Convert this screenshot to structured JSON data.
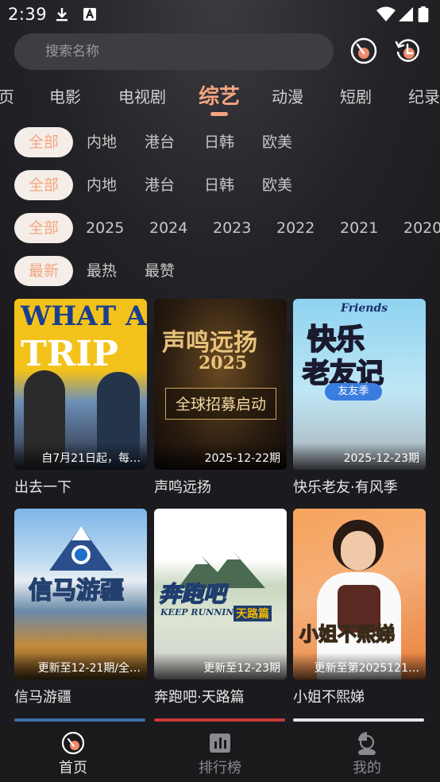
{
  "status_bar": {
    "time": "2:39"
  },
  "search": {
    "placeholder": "搜索名称"
  },
  "categories": [
    {
      "label": "页"
    },
    {
      "label": "电影"
    },
    {
      "label": "电视剧"
    },
    {
      "label": "综艺",
      "active": true
    },
    {
      "label": "动漫"
    },
    {
      "label": "短剧"
    },
    {
      "label": "纪录"
    }
  ],
  "filters": {
    "region1": [
      "全部",
      "内地",
      "港台",
      "日韩",
      "欧美"
    ],
    "region2": [
      "全部",
      "内地",
      "港台",
      "日韩",
      "欧美"
    ],
    "year": [
      "全部",
      "2025",
      "2024",
      "2023",
      "2022",
      "2021",
      "2020"
    ],
    "sort": [
      "最新",
      "最热",
      "最赞"
    ]
  },
  "posters": [
    {
      "title": "出去一下",
      "caption": "自7月21日起，每…",
      "art": "WHAT A TRIP"
    },
    {
      "title": "声鸣远扬",
      "caption": "2025-12-22期",
      "art": "声鸣远扬 2025 全球招募启动"
    },
    {
      "title": "快乐老友·有风季",
      "caption": "2025-12-23期",
      "art": "Friends 快乐老友记 友友季"
    },
    {
      "title": "信马游疆",
      "caption": "更新至12-21期/全…",
      "art": "信马游疆"
    },
    {
      "title": "奔跑吧·天路篇",
      "caption": "更新至12-23期",
      "art": "奔跑吧 天路篇 KEEP RUNNING"
    },
    {
      "title": "小姐不熙娣",
      "caption": "更新至第2025121…",
      "art": "小姐不熙娣"
    }
  ],
  "bottom_nav": [
    {
      "label": "首页",
      "icon": "home-icon",
      "active": true
    },
    {
      "label": "排行榜",
      "icon": "ranking-icon"
    },
    {
      "label": "我的",
      "icon": "profile-icon"
    }
  ],
  "colors": {
    "accent": "#f4a57e",
    "background": "#1b1b1f",
    "chip_selected_bg": "#f5eee8"
  }
}
